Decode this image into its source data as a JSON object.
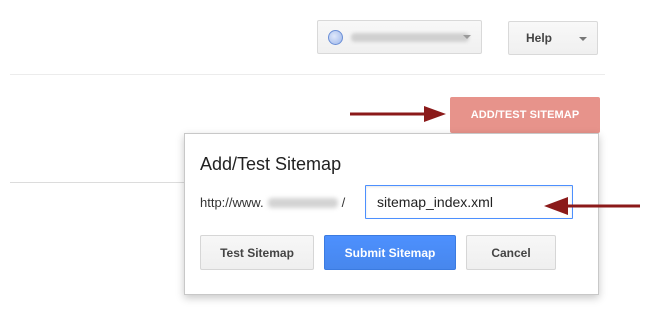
{
  "header": {
    "site_selector": {
      "icon": "globe-icon",
      "value": ""
    },
    "help_label": "Help"
  },
  "main": {
    "add_test_button": "ADD/TEST SITEMAP"
  },
  "dialog": {
    "title": "Add/Test Sitemap",
    "url_prefix_start": "http://www.",
    "url_prefix_end": "/",
    "input_value": "sitemap_index.xml",
    "test_button": "Test Sitemap",
    "submit_button": "Submit Sitemap",
    "cancel_button": "Cancel"
  },
  "annotations": {
    "arrow_color": "#8b1a1a"
  },
  "colors": {
    "accent_red_button": "#e7938b",
    "submit_blue": "#4d90fe",
    "input_focus_border": "#4d90fe"
  }
}
